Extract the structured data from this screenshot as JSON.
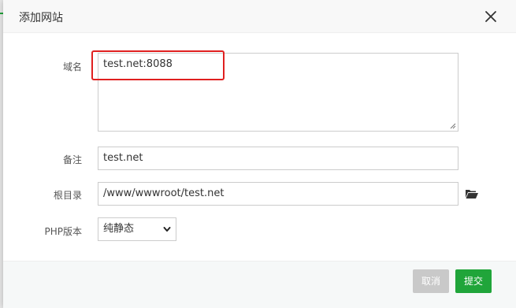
{
  "dialog": {
    "title": "添加网站",
    "close_icon": "close-icon"
  },
  "form": {
    "domain": {
      "label": "域名",
      "value": "test.net:8088"
    },
    "note": {
      "label": "备注",
      "value": "test.net"
    },
    "root_dir": {
      "label": "根目录",
      "value": "/www/wwwroot/test.net",
      "folder_icon": "folder-open-icon"
    },
    "php_version": {
      "label": "PHP版本",
      "selected": "纯静态"
    }
  },
  "footer": {
    "cancel_label": "取消",
    "submit_label": "提交"
  },
  "colors": {
    "accent": "#20a53a",
    "highlight": "#e02020",
    "cancel": "#c9c9c9"
  }
}
